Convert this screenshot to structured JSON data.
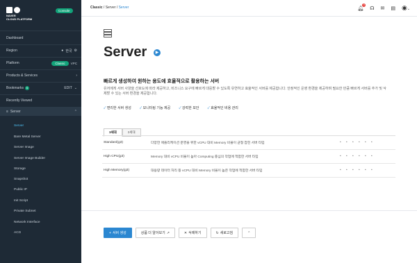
{
  "brand": {
    "line1": "NAVER",
    "line2": "CLOUD PLATFORM",
    "console_label": "Console"
  },
  "sidebar": {
    "dashboard": "Dashboard",
    "region_label": "Region",
    "region_value": "한국",
    "platform_label": "Platform",
    "platform_active": "Classic",
    "platform_other": "VPC",
    "products_label": "Products & Services",
    "bookmarks_label": "Bookmarks",
    "bookmarks_count": "6",
    "bookmarks_edit": "EDIT",
    "recently_viewed": "Recently Viewed",
    "server_parent": "Server",
    "items": [
      {
        "label": "Server"
      },
      {
        "label": "Bare Metal Server"
      },
      {
        "label": "Server Image"
      },
      {
        "label": "Server Image Builder"
      },
      {
        "label": "Storage"
      },
      {
        "label": "Snapshot"
      },
      {
        "label": "Public IP"
      },
      {
        "label": "Init Script"
      },
      {
        "label": "Private Subnet"
      },
      {
        "label": "Network Interface"
      },
      {
        "label": "ACG"
      }
    ]
  },
  "breadcrumb": {
    "a": "Classic",
    "b": "Server",
    "c": "Server"
  },
  "topbar": {
    "notif_count": "5"
  },
  "page": {
    "title": "Server",
    "headline": "빠르게 생성하여 원하는 용도에 효율적으로 활용하는 서버",
    "desc": "유저에게 서버 사양을 선호도에 따라 제공하고, 비즈니스 요구에 빠르게 대응할 수 있도록 유연하고 효율적인 서버를 제공합니다. 안정적인 운영 환경을 제공하며 필요한 만큼 빠르게 서버를 추가 및 삭제할 수 있는 서버 환경을 제공합니다.",
    "checks": [
      "편리한 서버 생성",
      "모니터링 기능 제공",
      "강력한 보안",
      "효율적인 비용 관리"
    ],
    "tabs": [
      "3세대",
      "2세대"
    ]
  },
  "table": {
    "rows": [
      {
        "name": "Standard(g3)",
        "desc": "다양한 애플리케이션 운영을 위한 vCPU 대비 Memory 비율이 균형 잡힌 서버 타입",
        "dots": "• • • • • •"
      },
      {
        "name": "High CPU(g3)",
        "desc": "Memory 대비 vCPU 비율이 높아 Computing 중심의 작업에 적합한 서버 타입",
        "dots": "• • • • • •"
      },
      {
        "name": "High Memory(g3)",
        "desc": "대용량 데이터 처리 등 vCPU 대비 Memory 비율이 높은 작업에 적합한 서버 타입",
        "dots": "• • • • • •"
      }
    ]
  },
  "actions": {
    "create": "서버 생성",
    "learn_more": "상품 더 알아보기",
    "delete": "삭제하기",
    "refresh": "새로고침"
  }
}
